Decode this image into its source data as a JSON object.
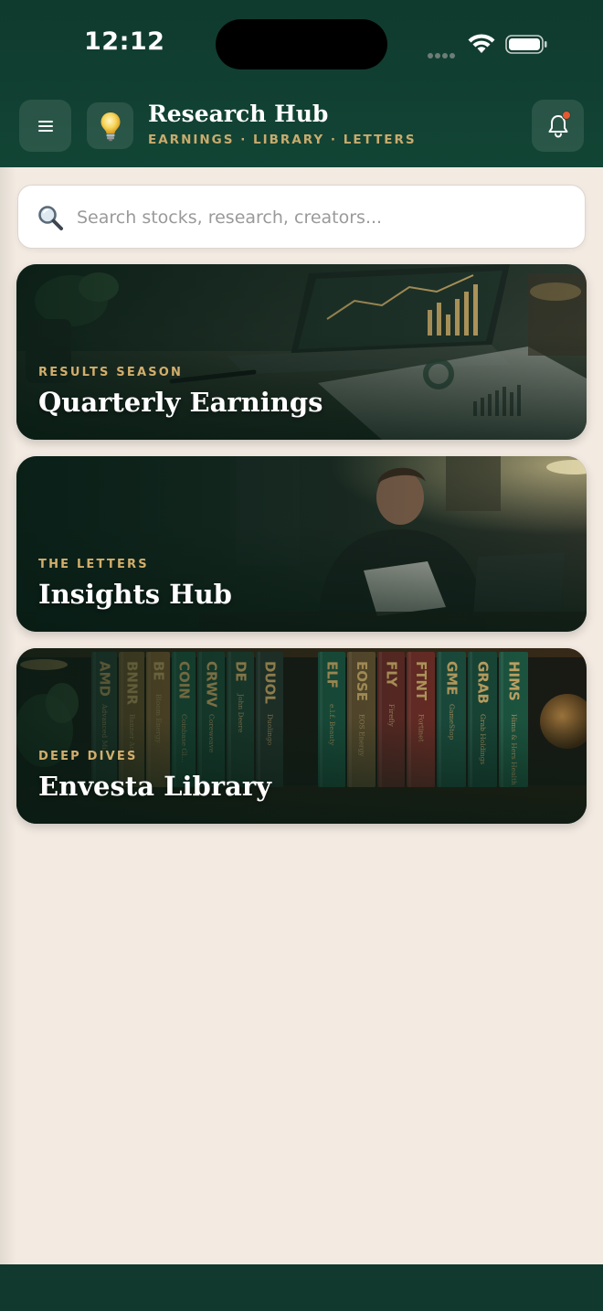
{
  "status_bar": {
    "time": "12:12"
  },
  "header": {
    "title": "Research Hub",
    "subtitle": "EARNINGS · LIBRARY · LETTERS",
    "menu_icon": "hamburger-menu-icon",
    "logo_icon": "lightbulb-icon",
    "notification_icon": "bell-icon",
    "has_unread_notification": true
  },
  "search": {
    "placeholder": "Search stocks, research, creators...",
    "value": ""
  },
  "cards": [
    {
      "eyebrow": "RESULTS SEASON",
      "title": "Quarterly Earnings",
      "image": "desk-laptop-charts-image"
    },
    {
      "eyebrow": "THE LETTERS",
      "title": "Insights Hub",
      "image": "man-reading-letter-image"
    },
    {
      "eyebrow": "DEEP DIVES",
      "title": "Envesta Library",
      "image": "bookshelf-image",
      "books": [
        {
          "ticker": "AMD",
          "name": "Advanced Mi...",
          "color": "#2f4a3c"
        },
        {
          "ticker": "BNNR",
          "name": "Banner Acq...",
          "color": "#7a5a2e"
        },
        {
          "ticker": "BE",
          "name": "Bloom Energy",
          "color": "#8a6434"
        },
        {
          "ticker": "COIN",
          "name": "Coinbase Gl...",
          "color": "#1f5a44"
        },
        {
          "ticker": "CRWV",
          "name": "Coreweave",
          "color": "#1e4d3b"
        },
        {
          "ticker": "DE",
          "name": "John Deere",
          "color": "#214536"
        },
        {
          "ticker": "DUOL",
          "name": "Duolingo",
          "color": "#283830"
        },
        {
          "ticker": "ELF",
          "name": "e.l.f. Beauty",
          "color": "#1d5a45"
        },
        {
          "ticker": "EOSE",
          "name": "EOS Energy",
          "color": "#6a5432"
        },
        {
          "ticker": "FLY",
          "name": "Firefly",
          "color": "#6a2a26"
        },
        {
          "ticker": "FTNT",
          "name": "Fortinet",
          "color": "#7a2e28"
        },
        {
          "ticker": "GME",
          "name": "GameStop",
          "color": "#1d5242"
        },
        {
          "ticker": "GRAB",
          "name": "Grab Holdings",
          "color": "#1a4a3a"
        },
        {
          "ticker": "HIMS",
          "name": "Hims & Hers Health",
          "color": "#1e5a44"
        }
      ]
    }
  ]
}
